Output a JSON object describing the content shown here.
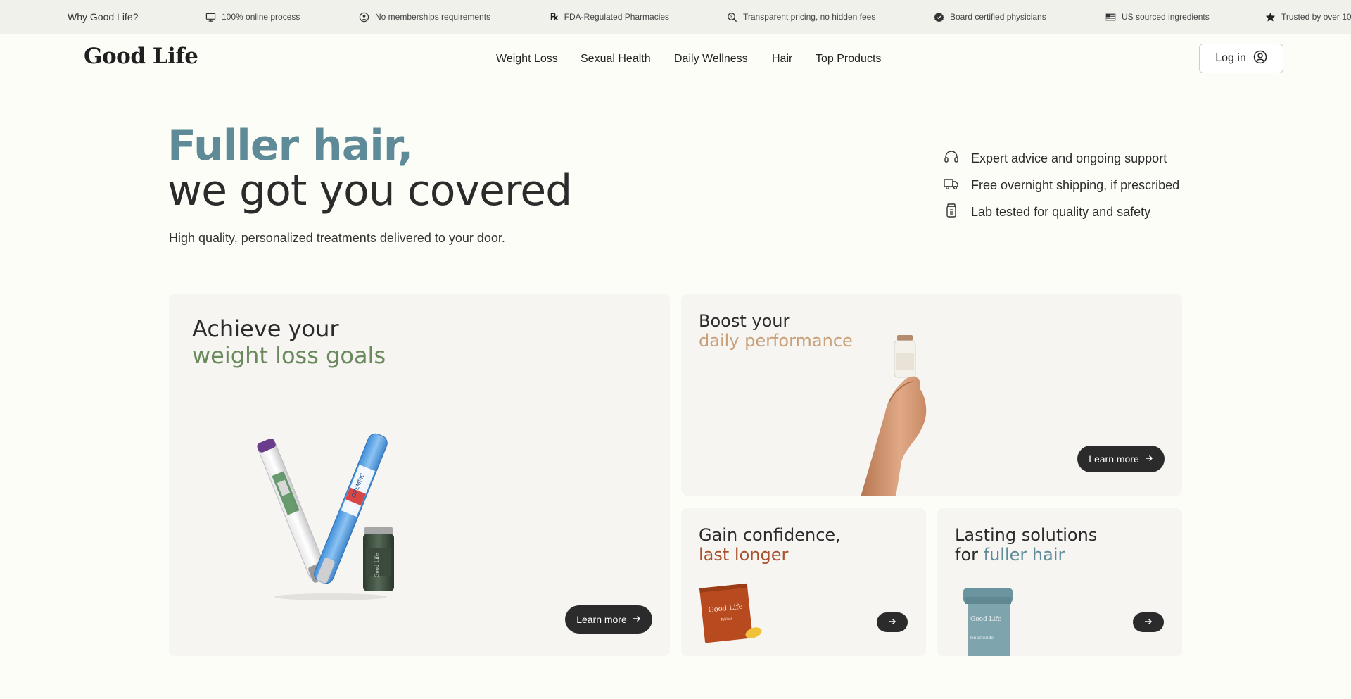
{
  "topbar": {
    "why": "Why Good Life?",
    "items": [
      {
        "icon": "monitor-icon",
        "label": "100% online process"
      },
      {
        "icon": "person-circle-icon",
        "label": "No memberships requirements"
      },
      {
        "icon": "rx-icon",
        "label": "FDA-Regulated Pharmacies"
      },
      {
        "icon": "magnifier-dollar-icon",
        "label": "Transparent pricing, no hidden fees"
      },
      {
        "icon": "certified-badge-icon",
        "label": "Board certified physicians"
      },
      {
        "icon": "us-flag-icon",
        "label": "US sourced ingredients"
      },
      {
        "icon": "star-icon",
        "label": "Trusted by over 10"
      }
    ]
  },
  "header": {
    "logo": "Good Life",
    "nav": [
      "Weight Loss",
      "Sexual Health",
      "Daily Wellness",
      "Hair",
      "Top Products"
    ],
    "login": "Log in"
  },
  "hero": {
    "line1": "Fuller hair,",
    "line2": "we got you covered",
    "subtitle": "High quality, personalized treatments delivered to your door.",
    "features": [
      {
        "icon": "headset-icon",
        "label": "Expert advice and ongoing support"
      },
      {
        "icon": "truck-icon",
        "label": "Free overnight shipping, if prescribed"
      },
      {
        "icon": "jar-icon",
        "label": "Lab tested for quality and safety"
      }
    ]
  },
  "cards": {
    "weight_loss": {
      "line1": "Achieve your",
      "line2": "weight loss goals",
      "button": "Learn more",
      "accent": "#6a8a5e",
      "pen_label": "OZEMPIC",
      "vial_label": "Good Life"
    },
    "performance": {
      "line1": "Boost your",
      "line2": "daily performance",
      "button": "Learn more",
      "accent": "#c9a07a"
    },
    "confidence": {
      "line1": "Gain confidence,",
      "line2": "last longer",
      "accent": "#a8512f",
      "packet_brand": "Good Life",
      "packet_label": "Tablets"
    },
    "hair": {
      "line1": "Lasting solutions",
      "line2_prefix": "for ",
      "line2": "fuller hair",
      "accent": "#5e8b97",
      "bottle_brand": "Good Life",
      "bottle_label": "Finasteride"
    }
  },
  "colors": {
    "hero_accent": "#5e8b97",
    "button_dark": "#2b2b2b",
    "card_bg": "#f6f5f1",
    "page_bg": "#fdfdf8"
  }
}
